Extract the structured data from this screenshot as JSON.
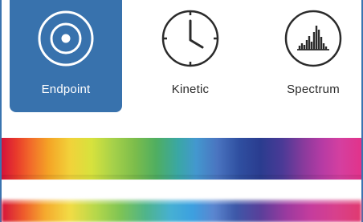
{
  "tabs": [
    {
      "id": "endpoint",
      "label": "Endpoint",
      "icon": "target-icon",
      "selected": true
    },
    {
      "id": "kinetic",
      "label": "Kinetic",
      "icon": "clock-icon",
      "selected": false
    },
    {
      "id": "spectrum",
      "label": "Spectrum",
      "icon": "spectrum-icon",
      "selected": false
    }
  ],
  "colors": {
    "selected_tab_bg": "#3872ad",
    "selected_tab_text": "#ffffff",
    "tab_text": "#2b2b2b",
    "icon_stroke": "#2b2b2b",
    "selected_icon_stroke": "#ffffff"
  }
}
